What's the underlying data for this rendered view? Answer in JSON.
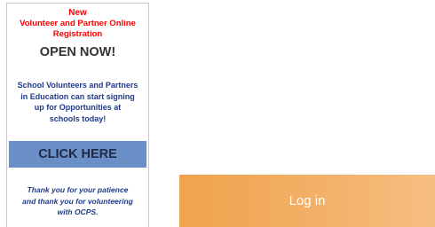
{
  "announcement": {
    "new_label": "New",
    "title_line1": "Volunteer and Partner Online",
    "title_line2": "Registration",
    "open_label": "OPEN NOW!",
    "body_line1": "School Volunteers and Partners",
    "body_line2": "in Education can start signing",
    "body_line3": "up for Opportunities at",
    "body_line4": "schools today!",
    "click_label": "CLICK HERE",
    "thanks_line1": "Thank you for your patience",
    "thanks_line2": "and thank you for volunteering",
    "thanks_line3": "with OCPS."
  },
  "login": {
    "label": "Log in"
  },
  "colors": {
    "accent_red": "#ff0000",
    "body_blue": "#1f3a8a",
    "click_bg": "#6a8fc6",
    "login_gradient_start": "#efa34b",
    "login_gradient_end": "#f6bf82"
  }
}
